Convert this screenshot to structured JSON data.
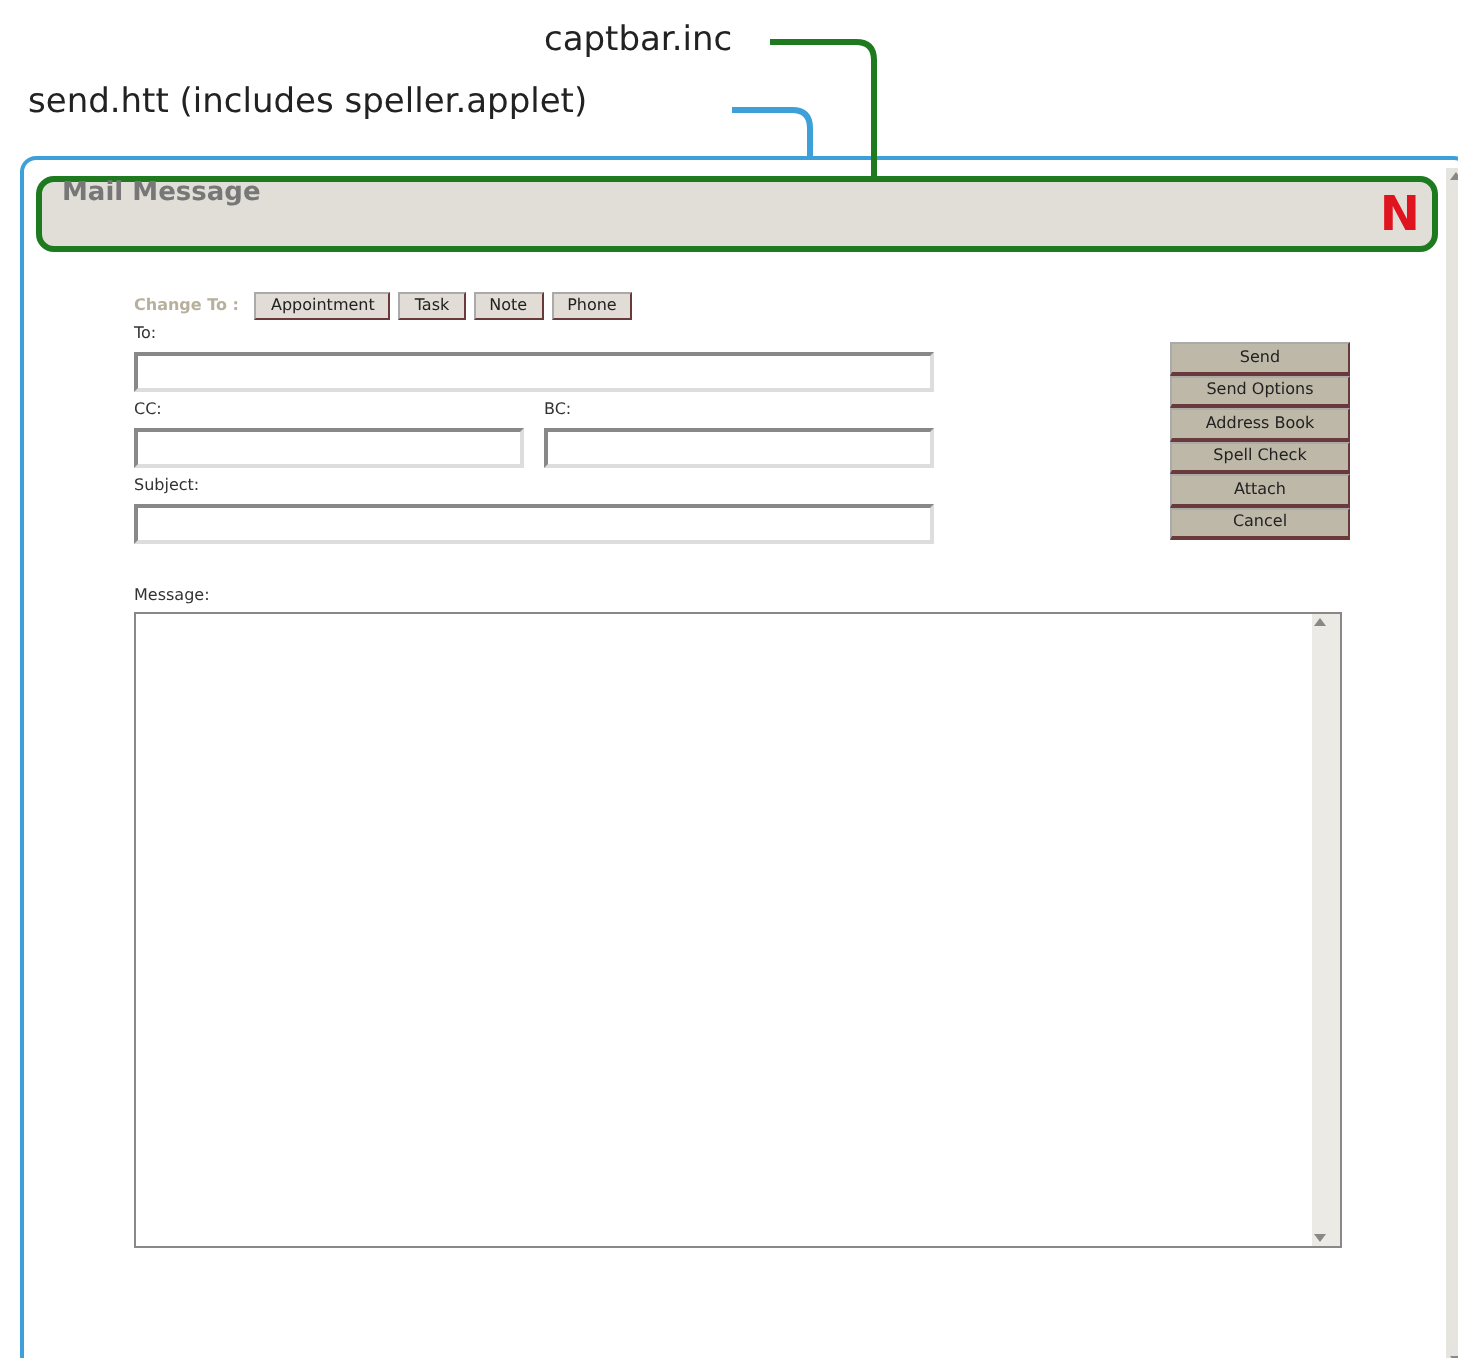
{
  "annotations": [
    {
      "label": "captbar.inc",
      "color": "#1e7a1e"
    },
    {
      "label": "send.htt (includes speller.applet)",
      "color": "#3ea0d8"
    }
  ],
  "window": {
    "title": "Mail Message",
    "logo": "N"
  },
  "change_to": {
    "label": "Change To :",
    "buttons": [
      "Appointment",
      "Task",
      "Note",
      "Phone"
    ]
  },
  "fields": [
    {
      "label": "To:",
      "kind": "wide"
    },
    {
      "label": "CC:",
      "kind": "half"
    },
    {
      "label": "BC:",
      "kind": "half"
    },
    {
      "label": "Subject:",
      "kind": "wide"
    }
  ],
  "message": {
    "label": "Message:"
  },
  "actions": [
    "Send",
    "Send Options",
    "Address Book",
    "Spell Check",
    "Attach",
    "Cancel"
  ]
}
